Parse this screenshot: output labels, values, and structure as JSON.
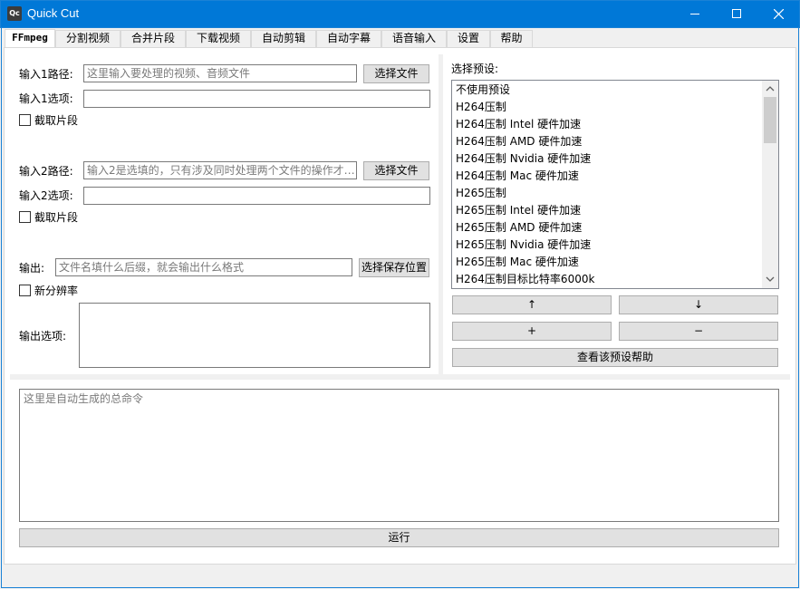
{
  "window": {
    "app_icon_text": "Qc",
    "title": "Quick Cut"
  },
  "tabs": [
    {
      "label": "FFmpeg",
      "active": true
    },
    {
      "label": "分割视频"
    },
    {
      "label": "合并片段"
    },
    {
      "label": "下载视频"
    },
    {
      "label": "自动剪辑"
    },
    {
      "label": "自动字幕"
    },
    {
      "label": "语音输入"
    },
    {
      "label": "设置"
    },
    {
      "label": "帮助"
    }
  ],
  "input1": {
    "path_label": "输入1路径:",
    "path_placeholder": "这里输入要处理的视频、音频文件",
    "choose_button": "选择文件",
    "options_label": "输入1选项:",
    "options_value": "",
    "clip_checkbox_label": "截取片段",
    "clip_checked": false
  },
  "input2": {
    "path_label": "输入2路径:",
    "path_placeholder": "输入2是选填的，只有涉及同时处理两个文件的操作才…",
    "choose_button": "选择文件",
    "options_label": "输入2选项:",
    "options_value": "",
    "clip_checkbox_label": "截取片段",
    "clip_checked": false
  },
  "output": {
    "label": "输出:",
    "placeholder": "文件名填什么后缀，就会输出什么格式",
    "save_button": "选择保存位置",
    "resolution_checkbox_label": "新分辨率",
    "resolution_checked": false,
    "options_label": "输出选项:",
    "options_value": ""
  },
  "presets": {
    "label": "选择预设:",
    "items": [
      "不使用预设",
      "H264压制",
      "H264压制 Intel 硬件加速",
      "H264压制 AMD 硬件加速",
      "H264压制 Nvidia 硬件加速",
      "H264压制 Mac 硬件加速",
      "H265压制",
      "H265压制 Intel 硬件加速",
      "H265压制 AMD 硬件加速",
      "H265压制 Nvidia 硬件加速",
      "H265压制 Mac 硬件加速",
      "H264压制目标比特率6000k"
    ],
    "up_button": "↑",
    "down_button": "↓",
    "add_button": "+",
    "remove_button": "−",
    "help_button": "查看该预设帮助"
  },
  "command": {
    "placeholder": "这里是自动生成的总命令"
  },
  "run_button": "运行",
  "colors": {
    "titlebar": "#0078d7",
    "window_bg": "#f0f0f0",
    "button_bg": "#e1e1e1",
    "placeholder_text": "#7a7a7a"
  }
}
